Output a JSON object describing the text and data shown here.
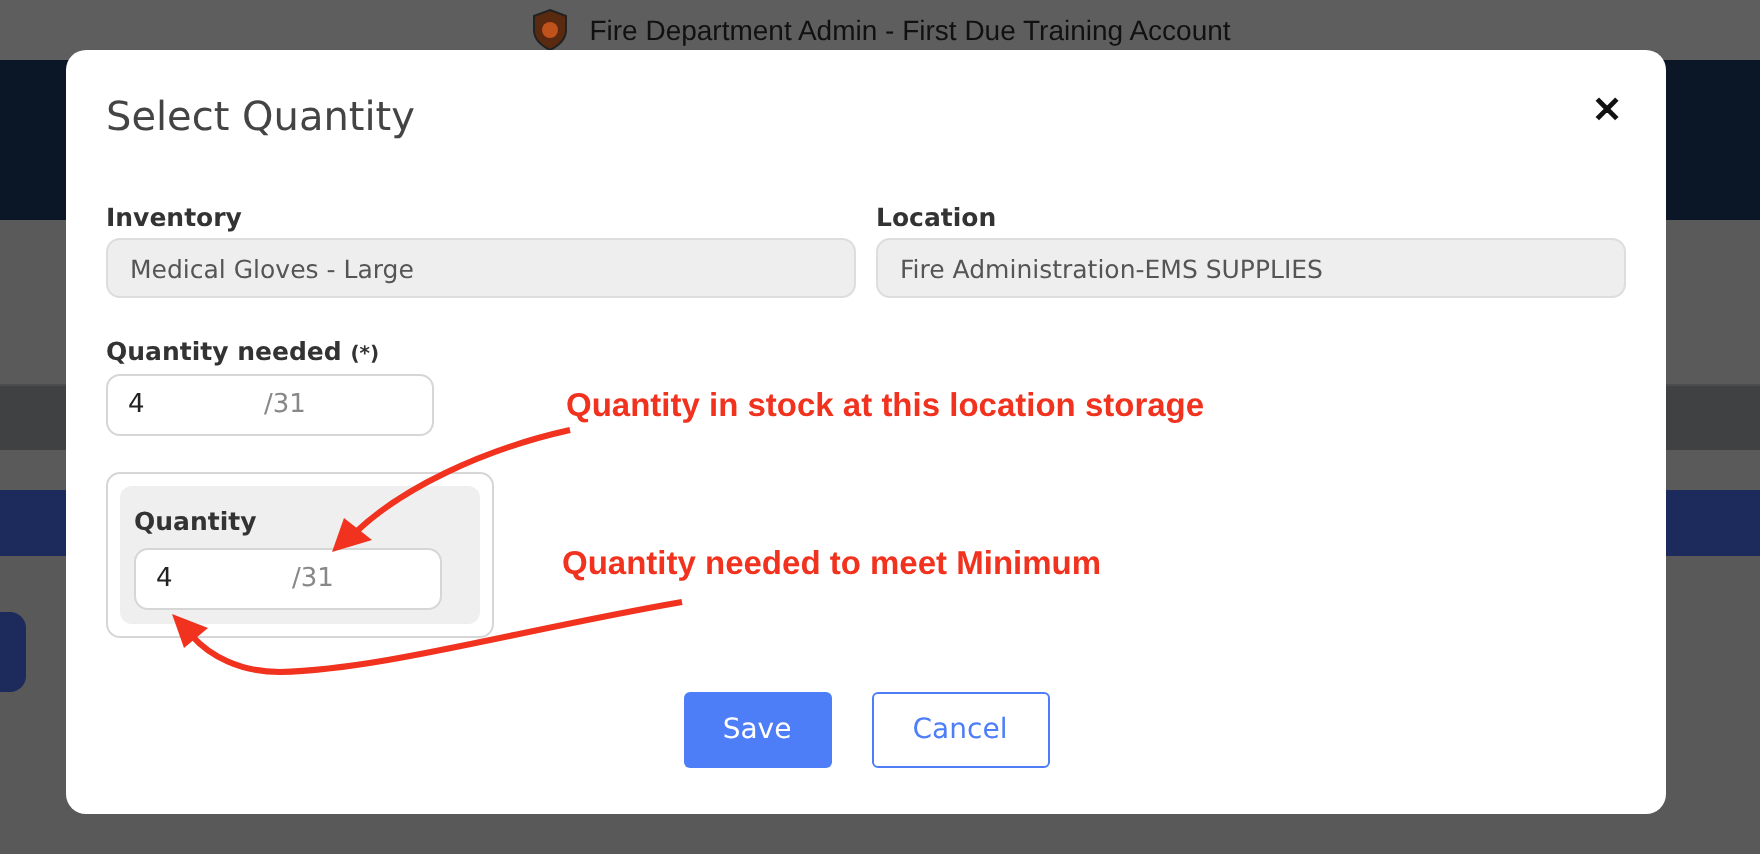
{
  "window": {
    "title": "Fire Department Admin - First Due Training Account"
  },
  "dialog": {
    "title": "Select Quantity",
    "close": "✕",
    "fields": [
      {
        "label": "Inventory",
        "value": "Medical Gloves - Large"
      },
      {
        "label": "Location",
        "value": "Fire Administration-EMS SUPPLIES"
      }
    ],
    "quantity_needed": {
      "label": "Quantity needed",
      "required": "(*)",
      "value": "4",
      "total": "/31"
    },
    "quantity": {
      "label": "Quantity",
      "value": "4",
      "total": "/31"
    },
    "buttons": [
      {
        "label": "Save",
        "kind": "primary"
      },
      {
        "label": "Cancel",
        "kind": "secondary"
      }
    ]
  },
  "annotations": [
    "Quantity in stock at this location storage",
    "Quantity needed to meet Minimum"
  ]
}
